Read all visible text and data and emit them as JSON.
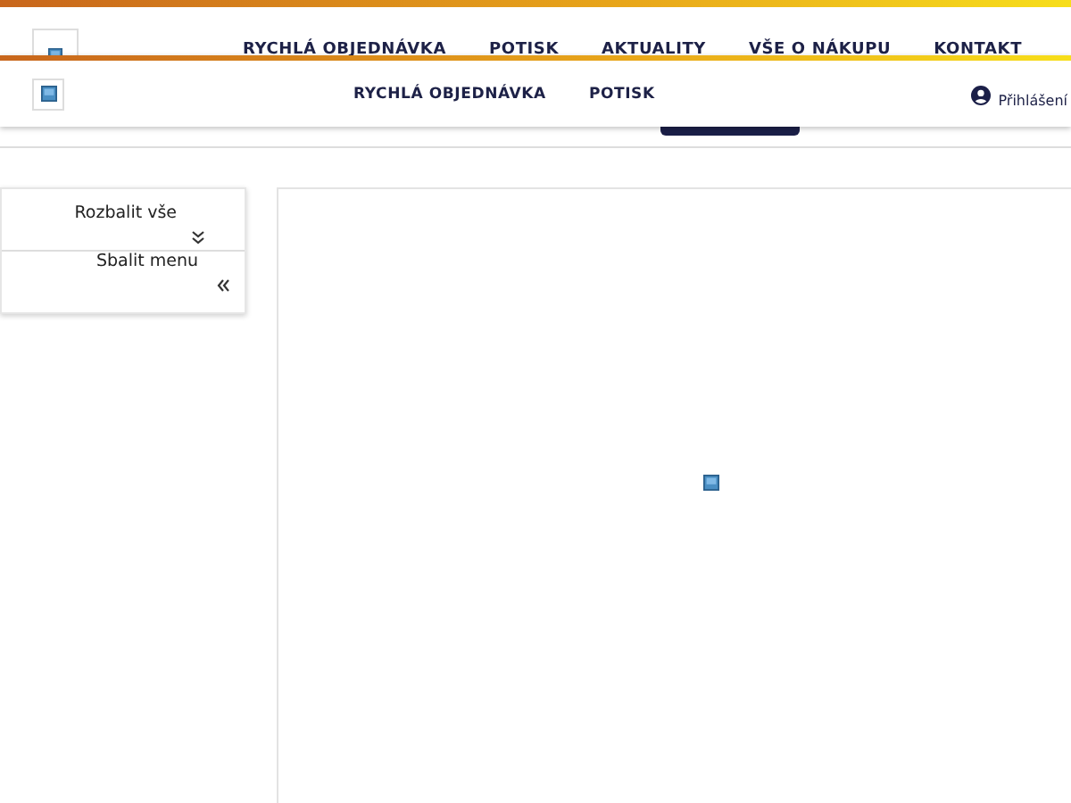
{
  "back_header": {
    "nav": [
      {
        "label": "RYCHLÁ OBJEDNÁVKA"
      },
      {
        "label": "POTISK"
      },
      {
        "label": "AKTUALITY"
      },
      {
        "label": "VŠE O NÁKUPU"
      },
      {
        "label": "KONTAKT"
      }
    ]
  },
  "sticky_header": {
    "nav": [
      {
        "label": "RYCHLÁ OBJEDNÁVKA"
      },
      {
        "label": "POTISK"
      }
    ],
    "account_link": "Přihlášení"
  },
  "sidebar": {
    "items": [
      {
        "kind": "expand",
        "label": "Rozbalit vše"
      },
      {
        "kind": "collapse",
        "label": "Sbalit menu"
      }
    ]
  }
}
